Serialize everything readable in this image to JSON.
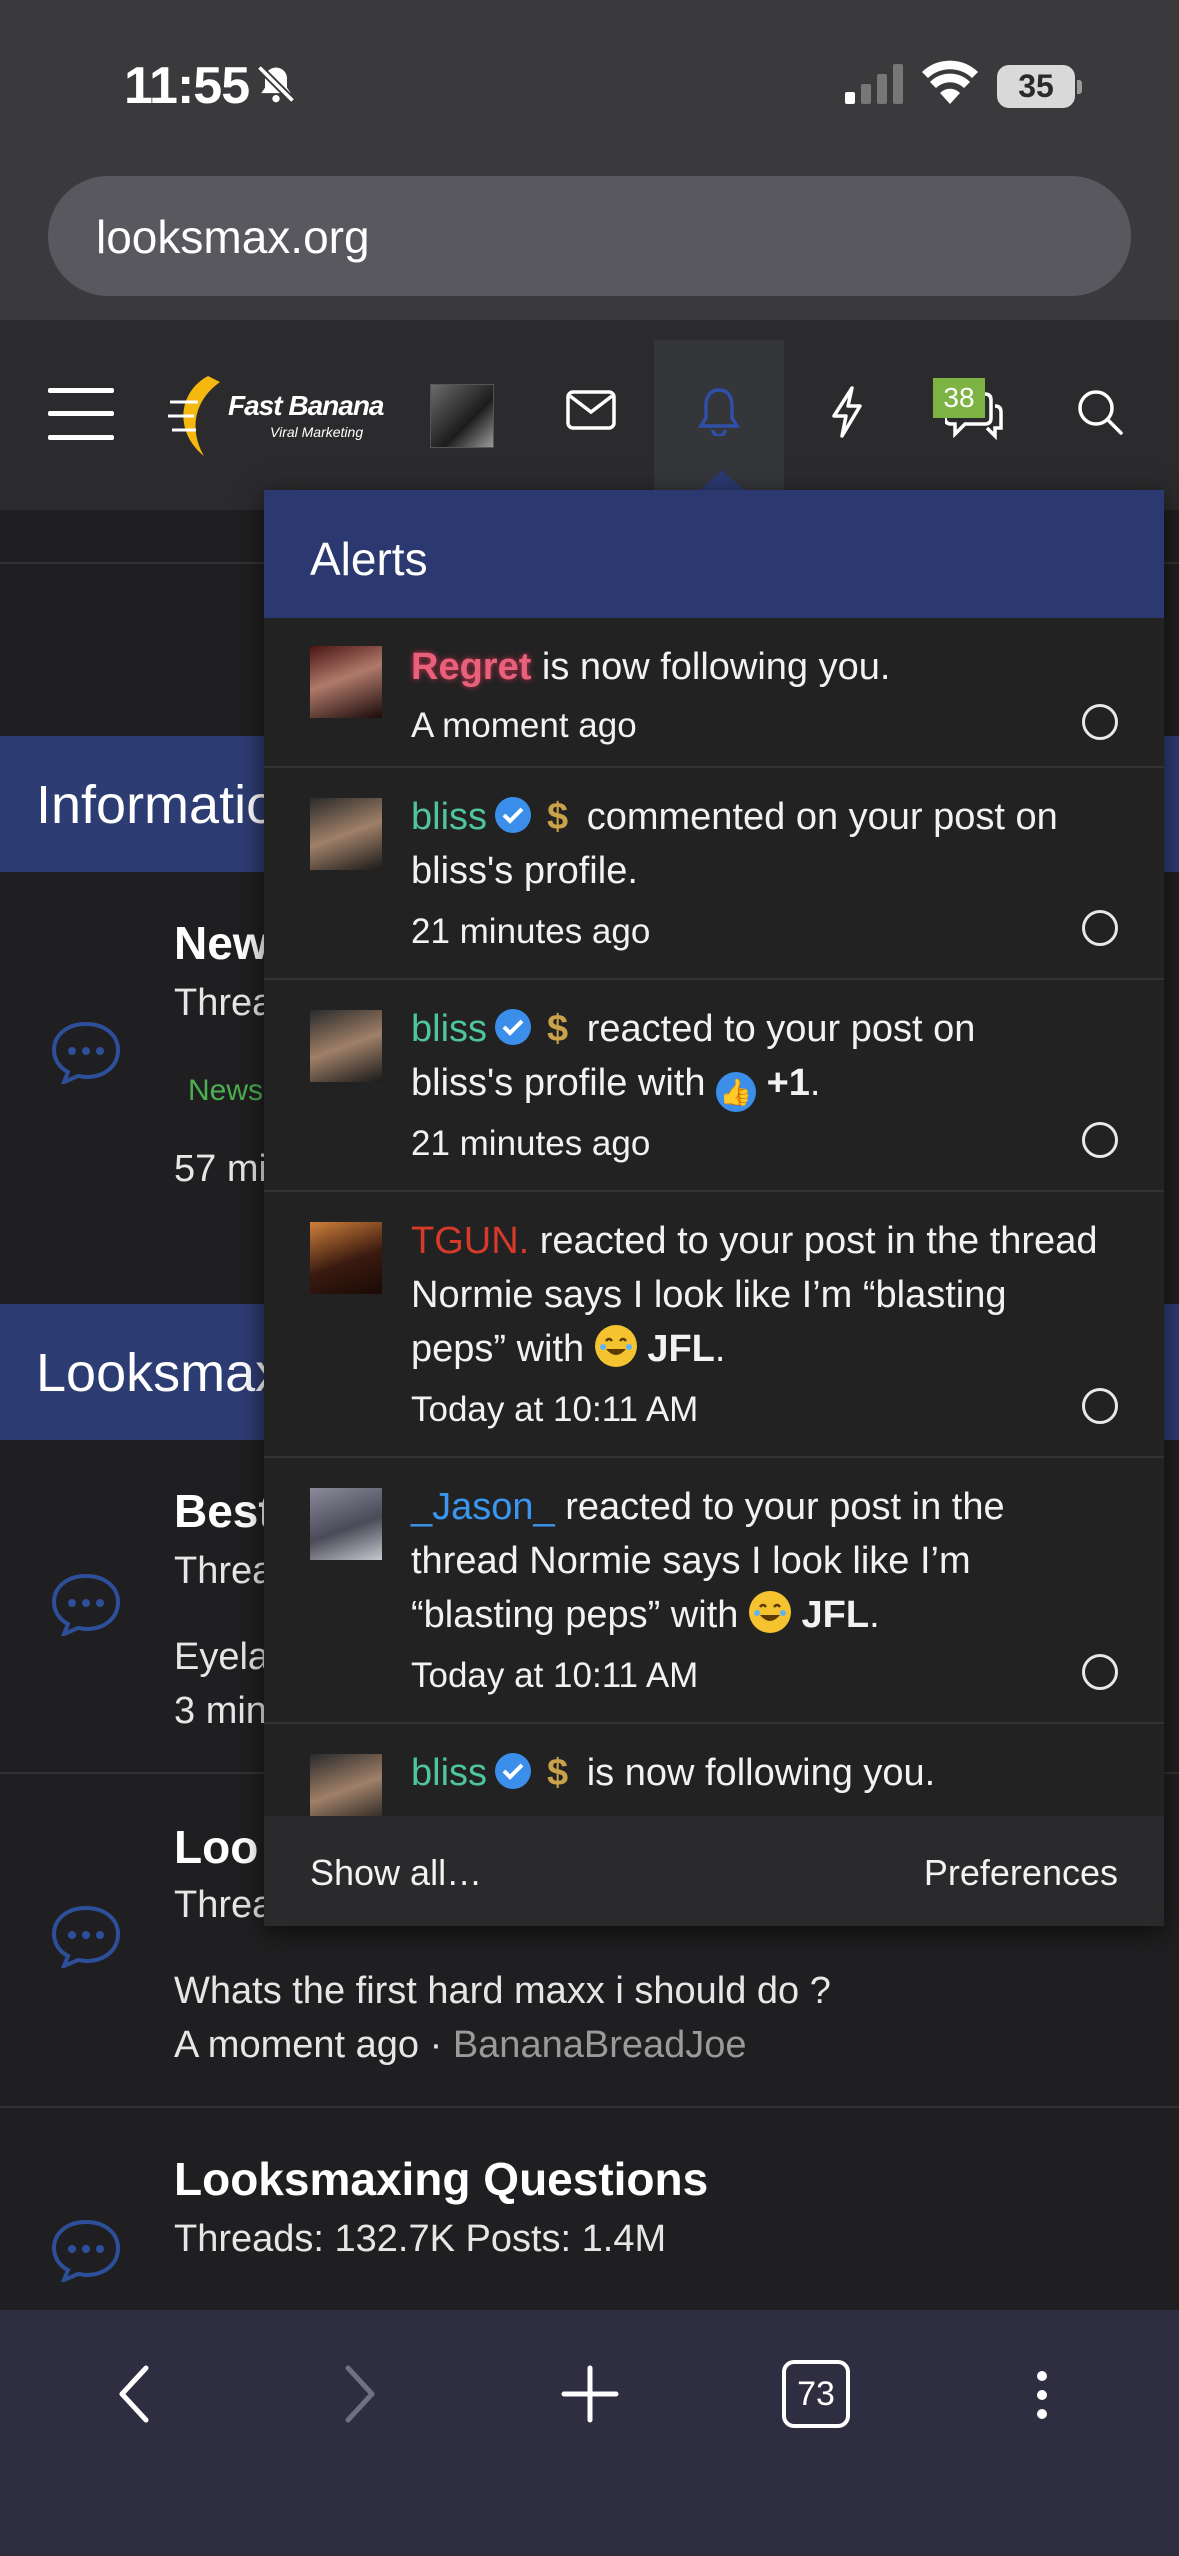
{
  "status_bar": {
    "time": "11:55",
    "battery": "35"
  },
  "browser": {
    "url": "looksmax.org",
    "tabs_count": "73"
  },
  "site_header": {
    "logo_text": "Fast Banana",
    "logo_subtext": "Viral Marketing",
    "conversations_badge": "38"
  },
  "forum": {
    "sections": [
      {
        "title": "Informatio"
      },
      {
        "title": "Looksmax"
      }
    ],
    "nodes": [
      {
        "title": "New",
        "stats": "Threa",
        "tag": "News",
        "meta": "57 mi"
      },
      {
        "title": "Best",
        "stats": "Threa",
        "last": "Eyela",
        "meta": "3 min"
      },
      {
        "title": "Loo",
        "stats": "Threa",
        "last": "Whats the first hard maxx i should do ?",
        "meta_time": "A moment ago",
        "meta_user": "BananaBreadJoe"
      },
      {
        "title": "Looksmaxing Questions",
        "stats": "Threads: 132.7K Posts: 1.4M"
      }
    ]
  },
  "alerts": {
    "title": "Alerts",
    "items": [
      {
        "user": "Regret",
        "text": " is now following you.",
        "time": "A moment ago"
      },
      {
        "user": "bliss",
        "text_a": " commented on your post on",
        "text_b": "bliss's profile.",
        "time": "21 minutes ago"
      },
      {
        "user": "bliss",
        "text_a": " reacted to your post on",
        "text_b": "bliss's profile with ",
        "reaction": "+1",
        "time": "21 minutes ago"
      },
      {
        "user": "TGUN.",
        "text_a": " reacted to your post in the thread",
        "text_b": "Normie says I look like I’m “blasting",
        "text_c": "peps” with ",
        "reaction": "JFL",
        "time": "Today at 10:11 AM"
      },
      {
        "user": "_Jason_",
        "text_a": " reacted to your post in the",
        "text_b": "thread Normie says I look like I’m",
        "text_c": "“blasting peps” with ",
        "reaction": "JFL",
        "time": "Today at 10:11 AM"
      },
      {
        "user": "bliss",
        "text": " is now following you."
      }
    ],
    "show_all": "Show all…",
    "preferences": "Preferences"
  }
}
